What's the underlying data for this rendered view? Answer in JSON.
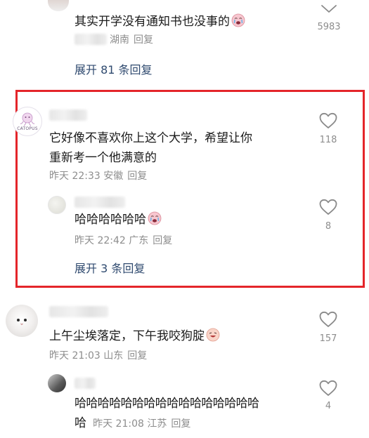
{
  "comments": [
    {
      "content": "其实开学没有通知书也没事的",
      "location": "湖南",
      "reply_label": "回复",
      "like_count": "5983",
      "expand_label": "展开 81 条回复"
    },
    {
      "avatar_text": "CATOPUS",
      "content_line1": "它好像不喜欢你上这个大学，希望让你",
      "content_line2": "重新考一个他满意的",
      "time": "昨天 22:33",
      "location": "安徽",
      "reply_label": "回复",
      "like_count": "118",
      "reply": {
        "content": "哈哈哈哈哈哈",
        "time": "昨天 22:42",
        "location": "广东",
        "reply_label": "回复",
        "like_count": "8"
      },
      "expand_label": "展开 3 条回复"
    },
    {
      "content": "上午尘埃落定，下午我咬狗腚",
      "time": "昨天 21:03",
      "location": "山东",
      "reply_label": "回复",
      "like_count": "157",
      "reply": {
        "content_line1": "哈哈哈哈哈哈哈哈哈哈哈哈哈哈哈哈",
        "content_line2": "哈",
        "time": "昨天 21:08",
        "location": "江苏",
        "reply_label": "回复",
        "like_count": "4"
      }
    }
  ],
  "colors": {
    "highlight": "#e4252a",
    "link": "#2f4a6f",
    "meta": "#8d8d8d"
  },
  "icons": {
    "like": "heart-outline-icon",
    "collapse": "chevron-down-icon",
    "emoji": "crying-face-emoji-icon",
    "emoji_alt": "laughing-face-emoji-icon"
  }
}
